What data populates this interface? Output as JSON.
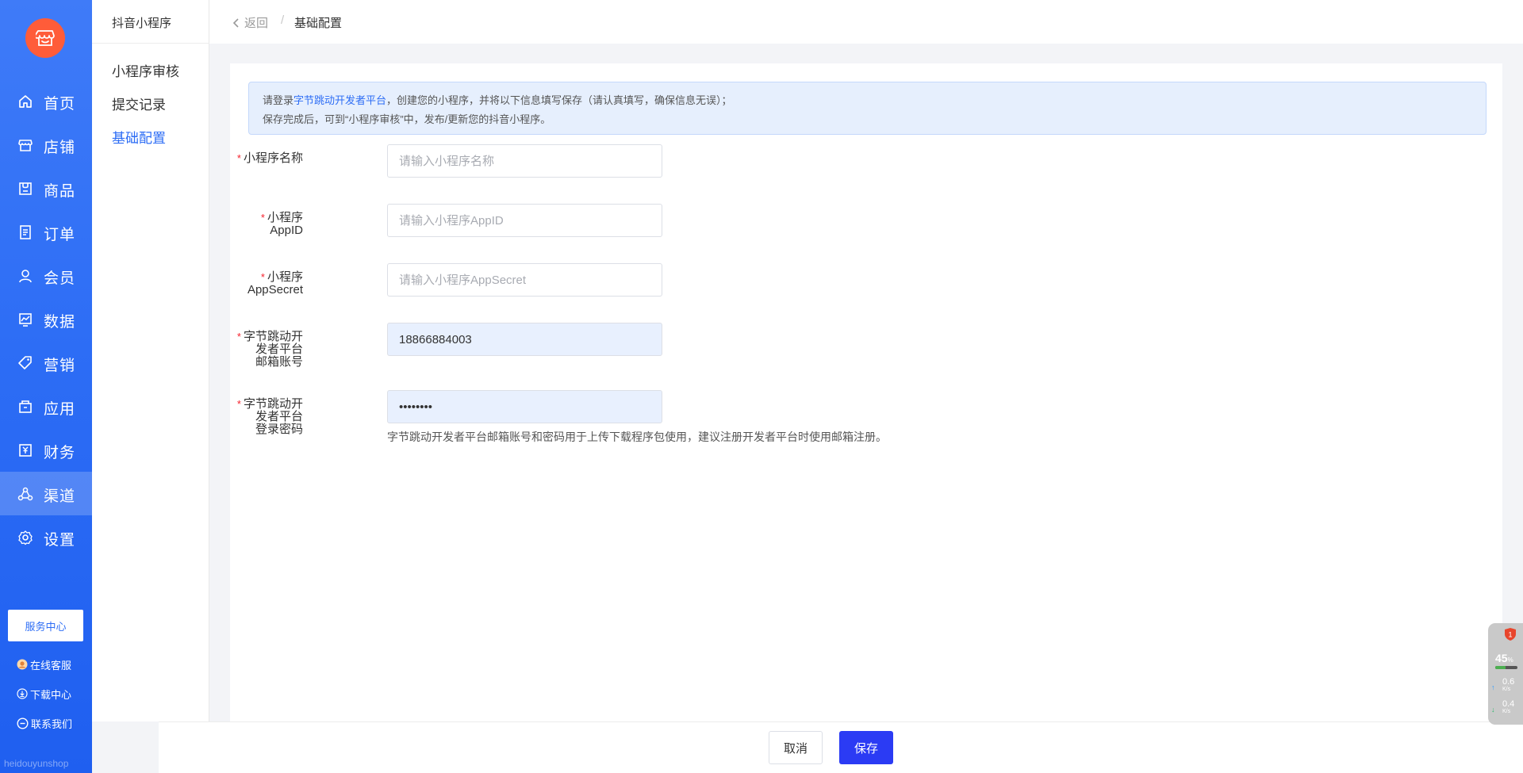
{
  "sidebar": {
    "items": [
      {
        "label": "首页",
        "icon": "home-icon"
      },
      {
        "label": "店铺",
        "icon": "store-icon"
      },
      {
        "label": "商品",
        "icon": "goods-icon"
      },
      {
        "label": "订单",
        "icon": "order-icon"
      },
      {
        "label": "会员",
        "icon": "member-icon"
      },
      {
        "label": "数据",
        "icon": "data-icon"
      },
      {
        "label": "营销",
        "icon": "tag-icon"
      },
      {
        "label": "应用",
        "icon": "app-icon"
      },
      {
        "label": "财务",
        "icon": "finance-icon"
      },
      {
        "label": "渠道",
        "icon": "channel-icon"
      },
      {
        "label": "设置",
        "icon": "gear-icon"
      }
    ],
    "active_index": 9,
    "service_center": "服务中心",
    "links": {
      "online_service": "在线客服",
      "download_center": "下载中心",
      "contact_us": "联系我们"
    },
    "watermark": "heidouyunshop"
  },
  "subnav": {
    "title": "抖音小程序",
    "items": [
      "小程序审核",
      "提交记录",
      "基础配置"
    ],
    "active_index": 2
  },
  "header": {
    "back": "返回",
    "separator": "/",
    "current": "基础配置"
  },
  "notice": {
    "line1_prefix": "请登录",
    "line1_link": "字节跳动开发者平台",
    "line1_suffix": "，创建您的小程序，并将以下信息填写保存（请认真填写，确保信息无误）；",
    "line2": "保存完成后，可到“小程序审核”中，发布/更新您的抖音小程序。"
  },
  "form": {
    "required_mark": "*",
    "name": {
      "label": "小程序名称",
      "placeholder": "请输入小程序名称",
      "value": ""
    },
    "appid": {
      "label": "小程序AppID",
      "placeholder": "请输入小程序AppID",
      "value": ""
    },
    "appsecret": {
      "label": "小程序AppSecret",
      "placeholder": "请输入小程序AppSecret",
      "value": ""
    },
    "email": {
      "label_line1": "字节跳动开发者平台",
      "label_line2": "邮箱账号",
      "value": "18866884003"
    },
    "password": {
      "label_line1": "字节跳动开发者平台",
      "label_line2": "登录密码",
      "value": "••••••••"
    },
    "hint": "字节跳动开发者平台邮箱账号和密码用于上传下载程序包使用，建议注册开发者平台时使用邮箱注册。"
  },
  "actions": {
    "cancel": "取消",
    "save": "保存"
  },
  "monitor": {
    "badge": "1",
    "percent": "45",
    "percent_unit": "%",
    "usage_fraction": 0.45,
    "upload": "0.6",
    "download": "0.4",
    "unit": "K/s"
  },
  "colors": {
    "primary": "#2d6df5",
    "save_button": "#2b3bf4",
    "logo": "#ff5c39",
    "required": "#f5222d"
  }
}
